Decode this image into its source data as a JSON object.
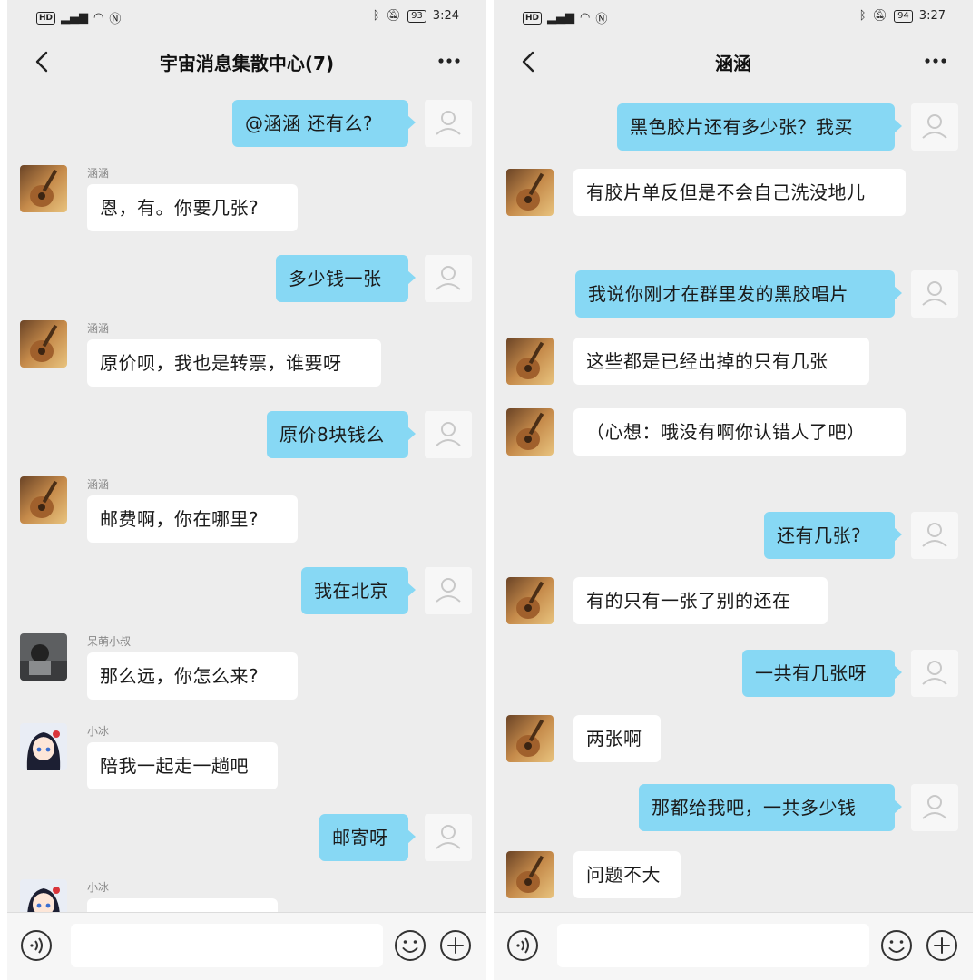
{
  "left": {
    "status": {
      "time": "3:24",
      "battery": "93"
    },
    "title": "宇宙消息集散中心(7)",
    "messages": [
      {
        "dir": "out",
        "text": "@涵涵 还有么?"
      },
      {
        "dir": "in",
        "sender": "涵涵",
        "avatar": "guitar",
        "text": "恩，有。你要几张?"
      },
      {
        "dir": "out",
        "text": "多少钱一张"
      },
      {
        "dir": "in",
        "sender": "涵涵",
        "avatar": "guitar",
        "text": "原价呗，我也是转票，谁要呀"
      },
      {
        "dir": "out",
        "text": "原价8块钱么"
      },
      {
        "dir": "in",
        "sender": "涵涵",
        "avatar": "guitar",
        "text": "邮费啊，你在哪里?"
      },
      {
        "dir": "out",
        "text": "我在北京"
      },
      {
        "dir": "in",
        "sender": "呆萌小叔",
        "avatar": "photo",
        "text": "那么远，你怎么来?"
      },
      {
        "dir": "in",
        "sender": "小冰",
        "avatar": "anime",
        "text": "陪我一起走一趟吧"
      },
      {
        "dir": "out",
        "text": "邮寄呀"
      },
      {
        "dir": "in",
        "sender": "小冰",
        "avatar": "anime",
        "text": ""
      }
    ]
  },
  "right": {
    "status": {
      "time": "3:27",
      "battery": "94"
    },
    "title": "涵涵",
    "messages": [
      {
        "dir": "out",
        "text": "黑色胶片还有多少张？我买"
      },
      {
        "dir": "in",
        "avatar": "guitar",
        "text": "有胶片单反但是不会自己洗没地儿"
      },
      {
        "dir": "out",
        "text": "我说你刚才在群里发的黑胶唱片"
      },
      {
        "dir": "in",
        "avatar": "guitar",
        "text": "这些都是已经出掉的只有几张"
      },
      {
        "dir": "in",
        "avatar": "guitar",
        "text": "（心想：哦没有啊你认错人了吧）"
      },
      {
        "dir": "out",
        "text": "还有几张?"
      },
      {
        "dir": "in",
        "avatar": "guitar",
        "text": "有的只有一张了别的还在"
      },
      {
        "dir": "out",
        "text": "一共有几张呀"
      },
      {
        "dir": "in",
        "avatar": "guitar",
        "text": "两张啊"
      },
      {
        "dir": "out",
        "text": "那都给我吧，一共多少钱"
      },
      {
        "dir": "in",
        "avatar": "guitar",
        "text": "问题不大"
      }
    ]
  },
  "input": {
    "placeholder": "",
    "value": ""
  },
  "colors": {
    "outgoing_bubble": "#87d8f4",
    "incoming_bubble": "#ffffff",
    "background": "#ededed"
  },
  "icons": [
    "back-icon",
    "more-icon",
    "voice-icon",
    "emoji-icon",
    "plus-icon",
    "default-avatar-icon"
  ]
}
